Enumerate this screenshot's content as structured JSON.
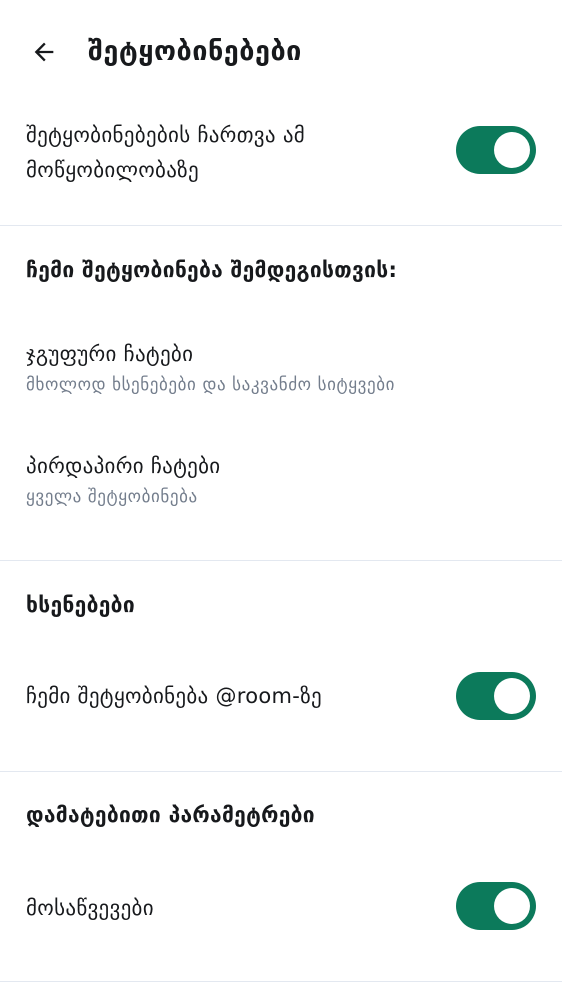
{
  "header": {
    "title": "შეტყობინებები",
    "back_icon": "arrow-left-icon"
  },
  "colors": {
    "accent": "#0c7a5b",
    "toggle_off": "#c1c6cd"
  },
  "master": {
    "label_line1": "შეტყობინებების ჩართვა ამ",
    "label_line2": "მოწყობილობაზე",
    "enabled": true
  },
  "notify_me_for": {
    "header": "ჩემი შეტყობინება შემდეგისთვის:",
    "items": [
      {
        "label": "ჯგუფური ჩატები",
        "sublabel": "მხოლოდ ხსენებები და საკვანძო სიტყვები"
      },
      {
        "label": "პირდაპირი ჩატები",
        "sublabel": "ყველა შეტყობინება"
      }
    ]
  },
  "mentions": {
    "header": "ხსენებები",
    "room_label": "ჩემი შეტყობინება @room-ზე",
    "room_enabled": true
  },
  "additional": {
    "header": "დამატებითი პარამეტრები",
    "invites_label": "მოსაწვევები",
    "invites_enabled": true
  }
}
